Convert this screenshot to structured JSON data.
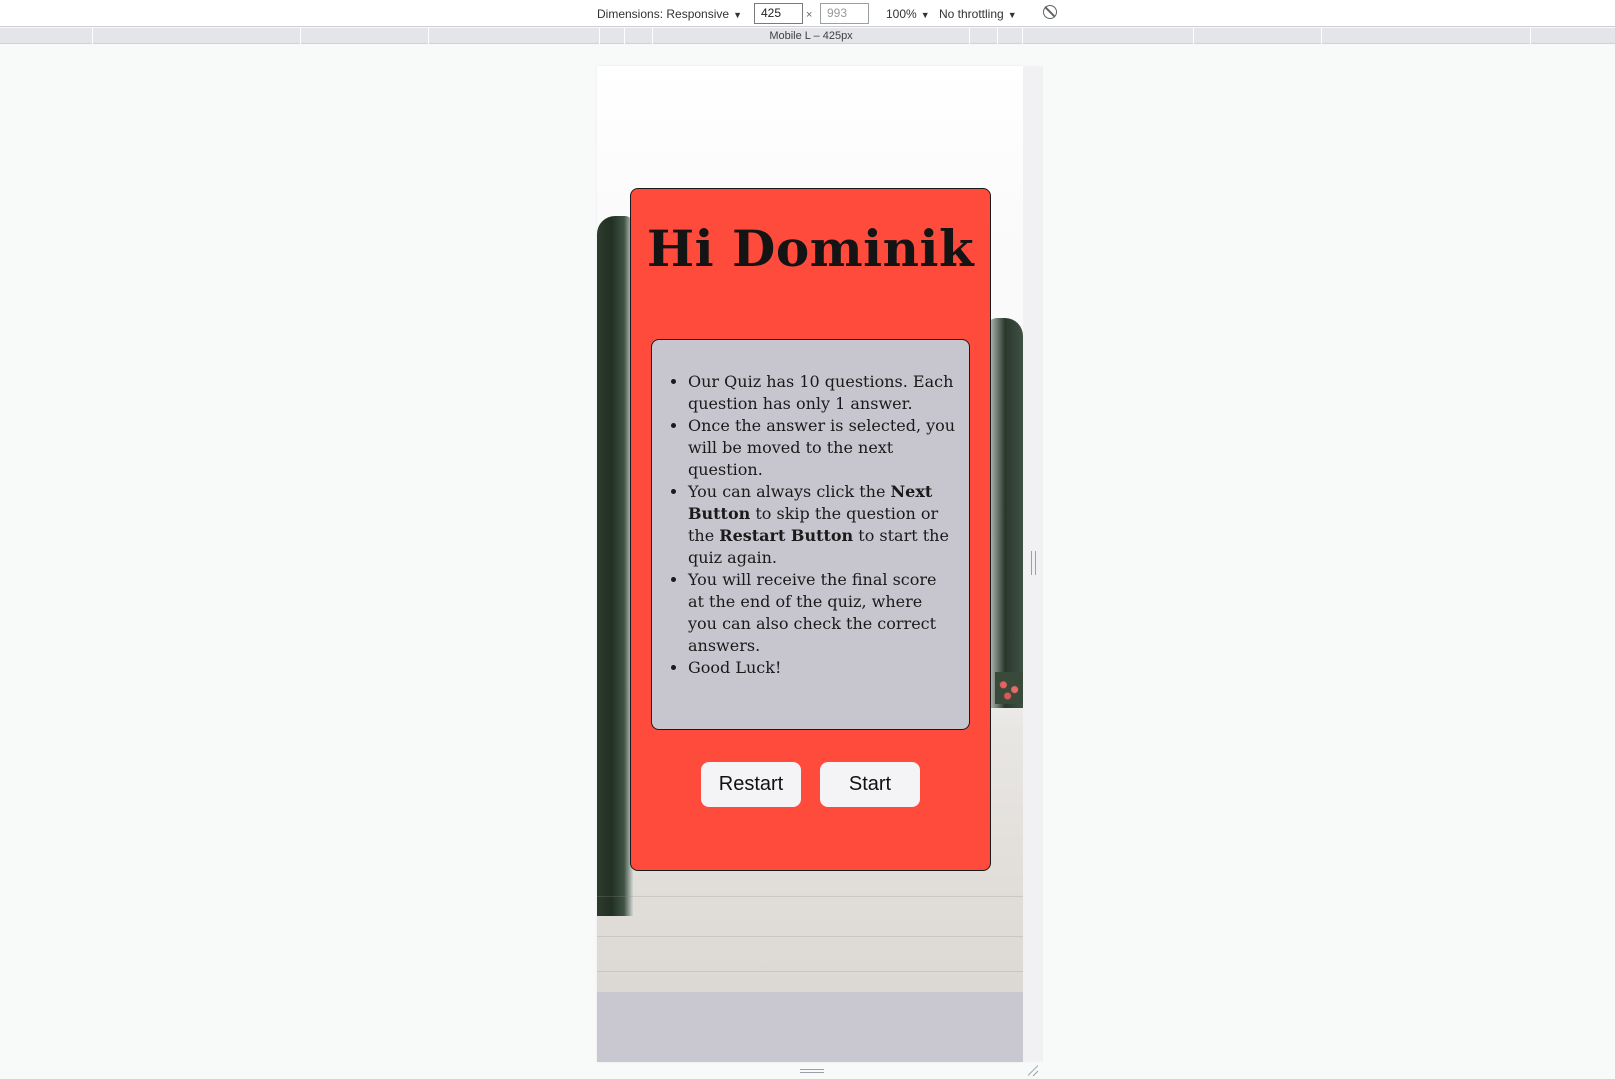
{
  "devtools": {
    "dimensions_label": "Dimensions: Responsive",
    "width_value": "425",
    "height_placeholder": "993",
    "times_sign": "×",
    "zoom": "100%",
    "throttling": "No throttling",
    "caret": "▼",
    "media_query_label": "Mobile L – 425px",
    "rotate_icon": "rotate-icon"
  },
  "quiz": {
    "greeting": "Hi Dominik",
    "rules": {
      "rule1": "Our Quiz has 10 questions. Each question has only 1 answer.",
      "rule2": "Once the answer is selected, you will be moved to the next question.",
      "rule3_a": "You can always click the ",
      "rule3_next": "Next Button",
      "rule3_b": " to skip the question or the ",
      "rule3_restart": "Restart Button",
      "rule3_c": " to start the quiz again.",
      "rule4": "You will receive the final score at the end of the quiz, where you can also check the correct answers.",
      "rule5": "Good Luck!"
    },
    "buttons": {
      "restart_label": "Restart",
      "start_label": "Start"
    },
    "colors": {
      "card_background": "#ff4b3c",
      "rules_background": "#c7c6cf",
      "button_background": "#f4f4f6"
    }
  }
}
